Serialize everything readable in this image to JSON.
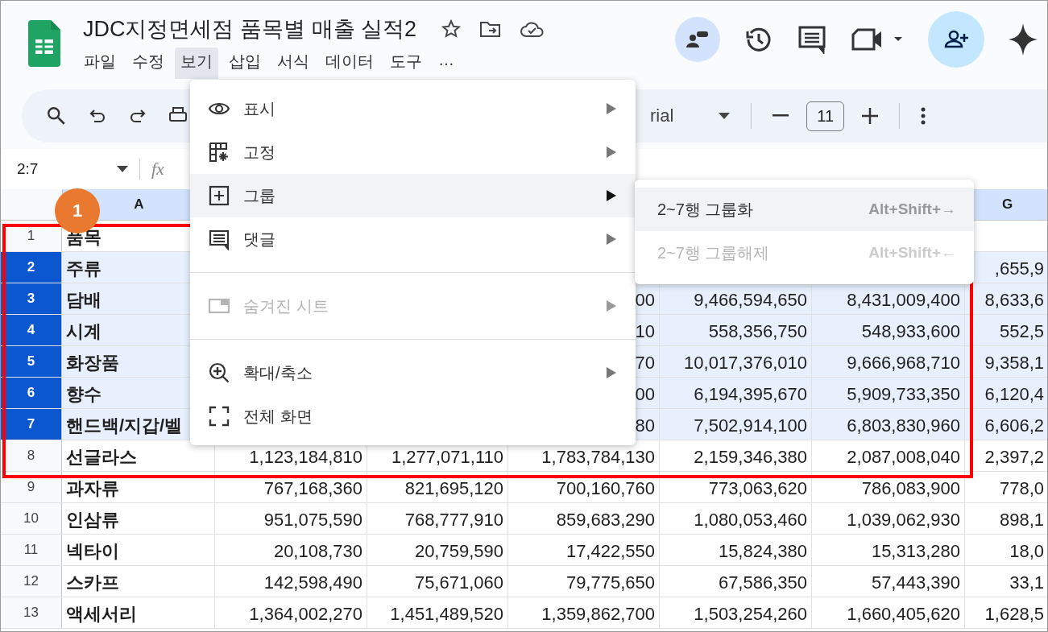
{
  "title": "JDC지정면세점 품목별 매출 실적2",
  "menubar": [
    {
      "label": "파일",
      "selected": false
    },
    {
      "label": "수정",
      "selected": false
    },
    {
      "label": "보기",
      "selected": true
    },
    {
      "label": "삽입",
      "selected": false
    },
    {
      "label": "서식",
      "selected": false
    },
    {
      "label": "데이터",
      "selected": false
    },
    {
      "label": "도구",
      "selected": false
    },
    {
      "label": "…",
      "selected": false
    }
  ],
  "toolbar": {
    "font": "rial",
    "font_size": "11"
  },
  "formula_bar": {
    "name_box": "2:7",
    "fx": "fx"
  },
  "columns": [
    {
      "label": "A",
      "selected": true
    },
    null,
    null,
    null,
    null,
    null,
    {
      "label": "G",
      "selected": true
    }
  ],
  "rows": [
    {
      "num": "1",
      "selected": false,
      "cells": [
        "품목",
        null,
        null,
        null,
        null,
        null,
        null
      ]
    },
    {
      "num": "2",
      "selected": true,
      "cells": [
        "주류",
        null,
        null,
        null,
        null,
        null,
        ",655,9"
      ]
    },
    {
      "num": "3",
      "selected": true,
      "cells": [
        "담배",
        null,
        null,
        "00",
        "9,466,594,650",
        "8,431,009,400",
        "8,633,6"
      ]
    },
    {
      "num": "4",
      "selected": true,
      "cells": [
        "시계",
        null,
        null,
        "10",
        "558,356,750",
        "548,933,600",
        "552,5"
      ]
    },
    {
      "num": "5",
      "selected": true,
      "cells": [
        "화장품",
        null,
        null,
        "70",
        "10,017,376,010",
        "9,666,968,710",
        "9,358,1"
      ]
    },
    {
      "num": "6",
      "selected": true,
      "cells": [
        "향수",
        null,
        null,
        "00",
        "6,194,395,670",
        "5,909,733,350",
        "6,120,4"
      ]
    },
    {
      "num": "7",
      "selected": true,
      "cells": [
        "핸드백/지갑/벨",
        null,
        null,
        "80",
        "7,502,914,100",
        "6,803,830,960",
        "6,606,2"
      ]
    },
    {
      "num": "8",
      "selected": false,
      "cells": [
        "선글라스",
        "1,123,184,810",
        "1,277,071,110",
        "1,783,784,130",
        "2,159,346,380",
        "2,087,008,040",
        "2,397,2"
      ]
    },
    {
      "num": "9",
      "selected": false,
      "cells": [
        "과자류",
        "767,168,360",
        "821,695,120",
        "700,160,760",
        "773,063,620",
        "786,083,900",
        "778,0"
      ]
    },
    {
      "num": "10",
      "selected": false,
      "cells": [
        "인삼류",
        "951,075,590",
        "768,777,910",
        "859,683,290",
        "1,080,053,460",
        "1,039,062,930",
        "898,1"
      ]
    },
    {
      "num": "11",
      "selected": false,
      "cells": [
        "넥타이",
        "20,108,730",
        "20,759,590",
        "17,422,550",
        "15,824,380",
        "15,313,280",
        "18,0"
      ]
    },
    {
      "num": "12",
      "selected": false,
      "cells": [
        "스카프",
        "142,598,490",
        "75,671,060",
        "79,775,650",
        "67,586,350",
        "57,443,390",
        "33,1"
      ]
    },
    {
      "num": "13",
      "selected": false,
      "cells": [
        "액세서리",
        "1,364,002,270",
        "1,451,489,520",
        "1,359,862,700",
        "1,503,254,260",
        "1,660,405,620",
        "1,628,5"
      ]
    }
  ],
  "view_menu": [
    {
      "kind": "item",
      "label": "표시",
      "submenu": true,
      "selected": false,
      "disabled": false
    },
    {
      "kind": "item",
      "label": "고정",
      "submenu": true,
      "selected": false,
      "disabled": false
    },
    {
      "kind": "item",
      "label": "그룹",
      "submenu": true,
      "selected": true,
      "disabled": false
    },
    {
      "kind": "item",
      "label": "댓글",
      "submenu": true,
      "selected": false,
      "disabled": false
    },
    {
      "kind": "divider"
    },
    {
      "kind": "item",
      "label": "숨겨진 시트",
      "submenu": true,
      "selected": false,
      "disabled": true
    },
    {
      "kind": "divider"
    },
    {
      "kind": "item",
      "label": "확대/축소",
      "submenu": true,
      "selected": false,
      "disabled": false
    },
    {
      "kind": "item",
      "label": "전체 화면",
      "submenu": false,
      "selected": false,
      "disabled": false
    }
  ],
  "group_submenu": [
    {
      "label": "2~7행 그룹화",
      "shortcut": "Alt+Shift+→",
      "selected": true,
      "disabled": false
    },
    {
      "label": "2~7행 그룹해제",
      "shortcut": "Alt+Shift+←",
      "selected": false,
      "disabled": true
    }
  ],
  "annotation": {
    "badge": "1"
  }
}
